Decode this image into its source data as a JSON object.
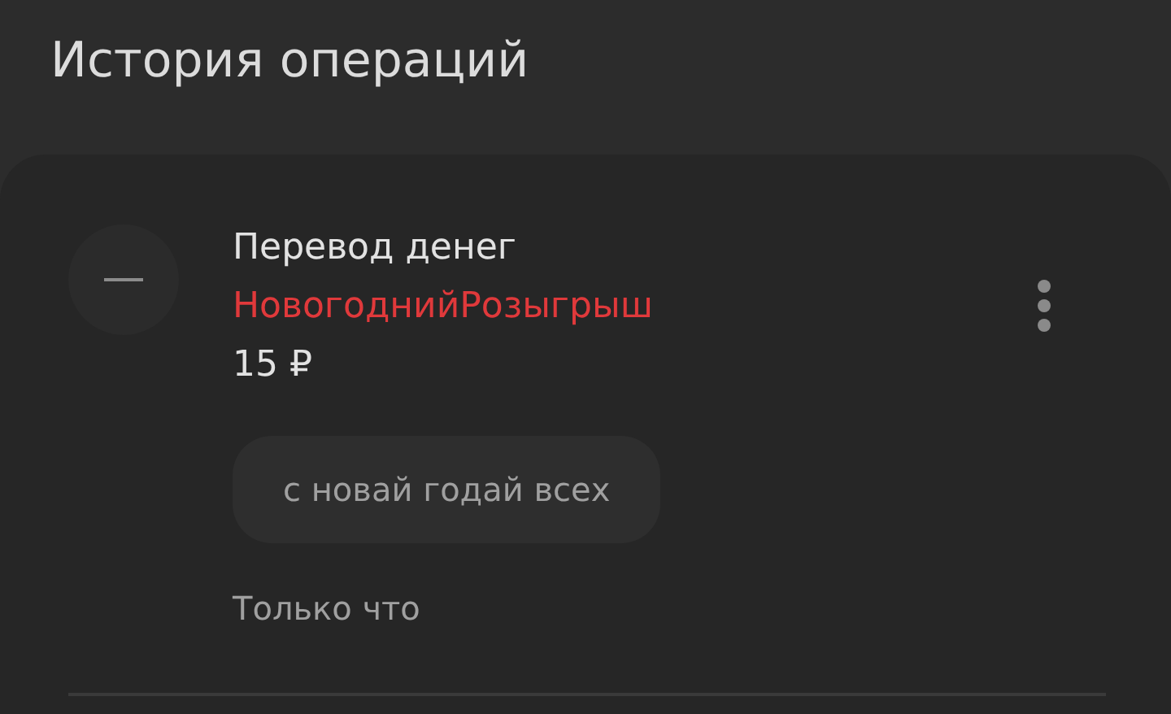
{
  "header": {
    "title": "История операций"
  },
  "operations": [
    {
      "title": "Перевод денег",
      "recipient": "НовогоднийРозыгрыш",
      "amount": "15 ₽",
      "comment": "с новай годай всех",
      "time": "Только что"
    }
  ]
}
